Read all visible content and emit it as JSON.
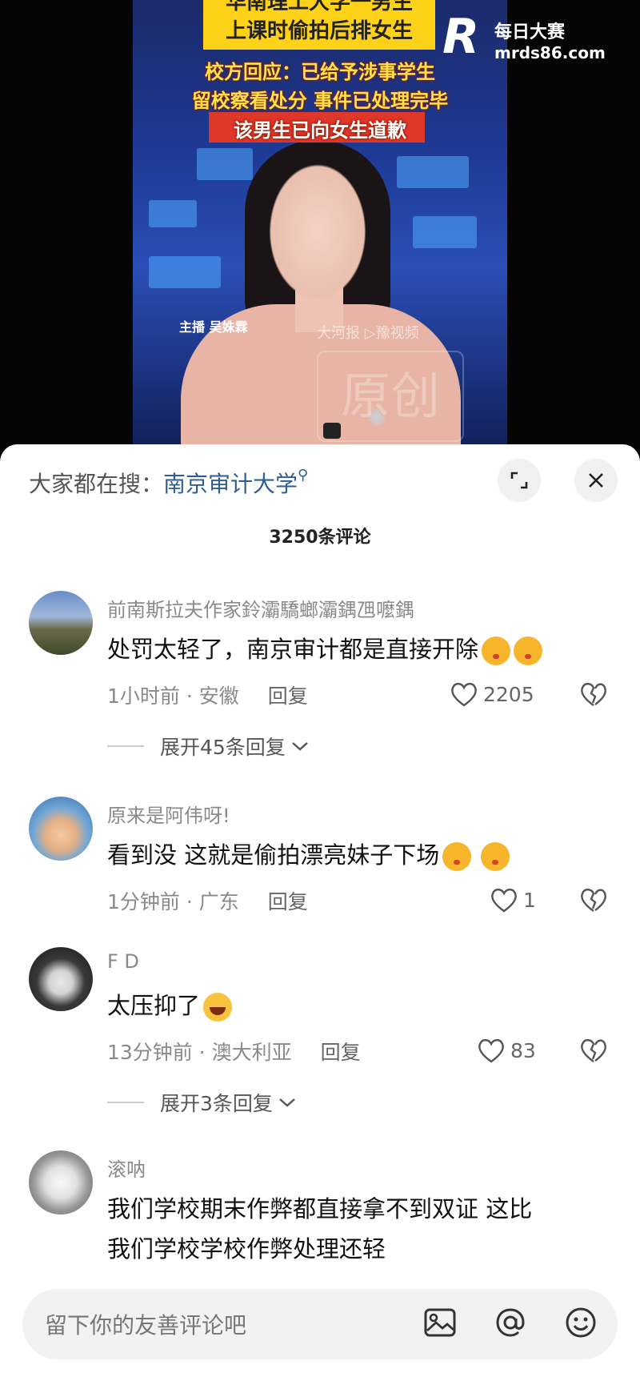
{
  "video": {
    "headline_line1": "华南理工大学一男生",
    "headline_line2": "上课时偷拍后排女生",
    "sub_line1": "校方回应：已给予涉事学生",
    "sub_line2": "留校察看处分 事件已处理完毕",
    "sub_line3": "该男生已向女生道歉",
    "anchor_label": "主播 吴姝霖",
    "source_mark": "大河报 ▷豫视频",
    "original_stamp": "原创",
    "watermark_cn": "每日大赛",
    "watermark_url": "mrds86.com"
  },
  "sheet": {
    "search_prefix": "大家都在搜：",
    "search_keyword": "南京审计大学",
    "comment_count": "3250条评论"
  },
  "comments": [
    {
      "user": "前南斯拉夫作家鈴灞驕螂灞鍝乪嚒鍝",
      "text": "处罚太轻了，南京审计都是直接开除",
      "time": "1小时前 · 安徽",
      "reply": "回复",
      "likes": "2205",
      "expand": "展开45条回复"
    },
    {
      "user": "原来是阿伟呀!",
      "text": "看到没 这就是偷拍漂亮妹子下场",
      "time": "1分钟前 · 广东",
      "reply": "回复",
      "likes": "1"
    },
    {
      "user": "F D",
      "text": "太压抑了",
      "time": "13分钟前 · 澳大利亚",
      "reply": "回复",
      "likes": "83",
      "expand": "展开3条回复"
    },
    {
      "user": "滚呐",
      "text_line1": "我们学校期末作弊都直接拿不到双证 这比",
      "text_line2": "我们学校学校作弊处理还轻"
    }
  ],
  "input": {
    "placeholder": "留下你的友善评论吧"
  }
}
